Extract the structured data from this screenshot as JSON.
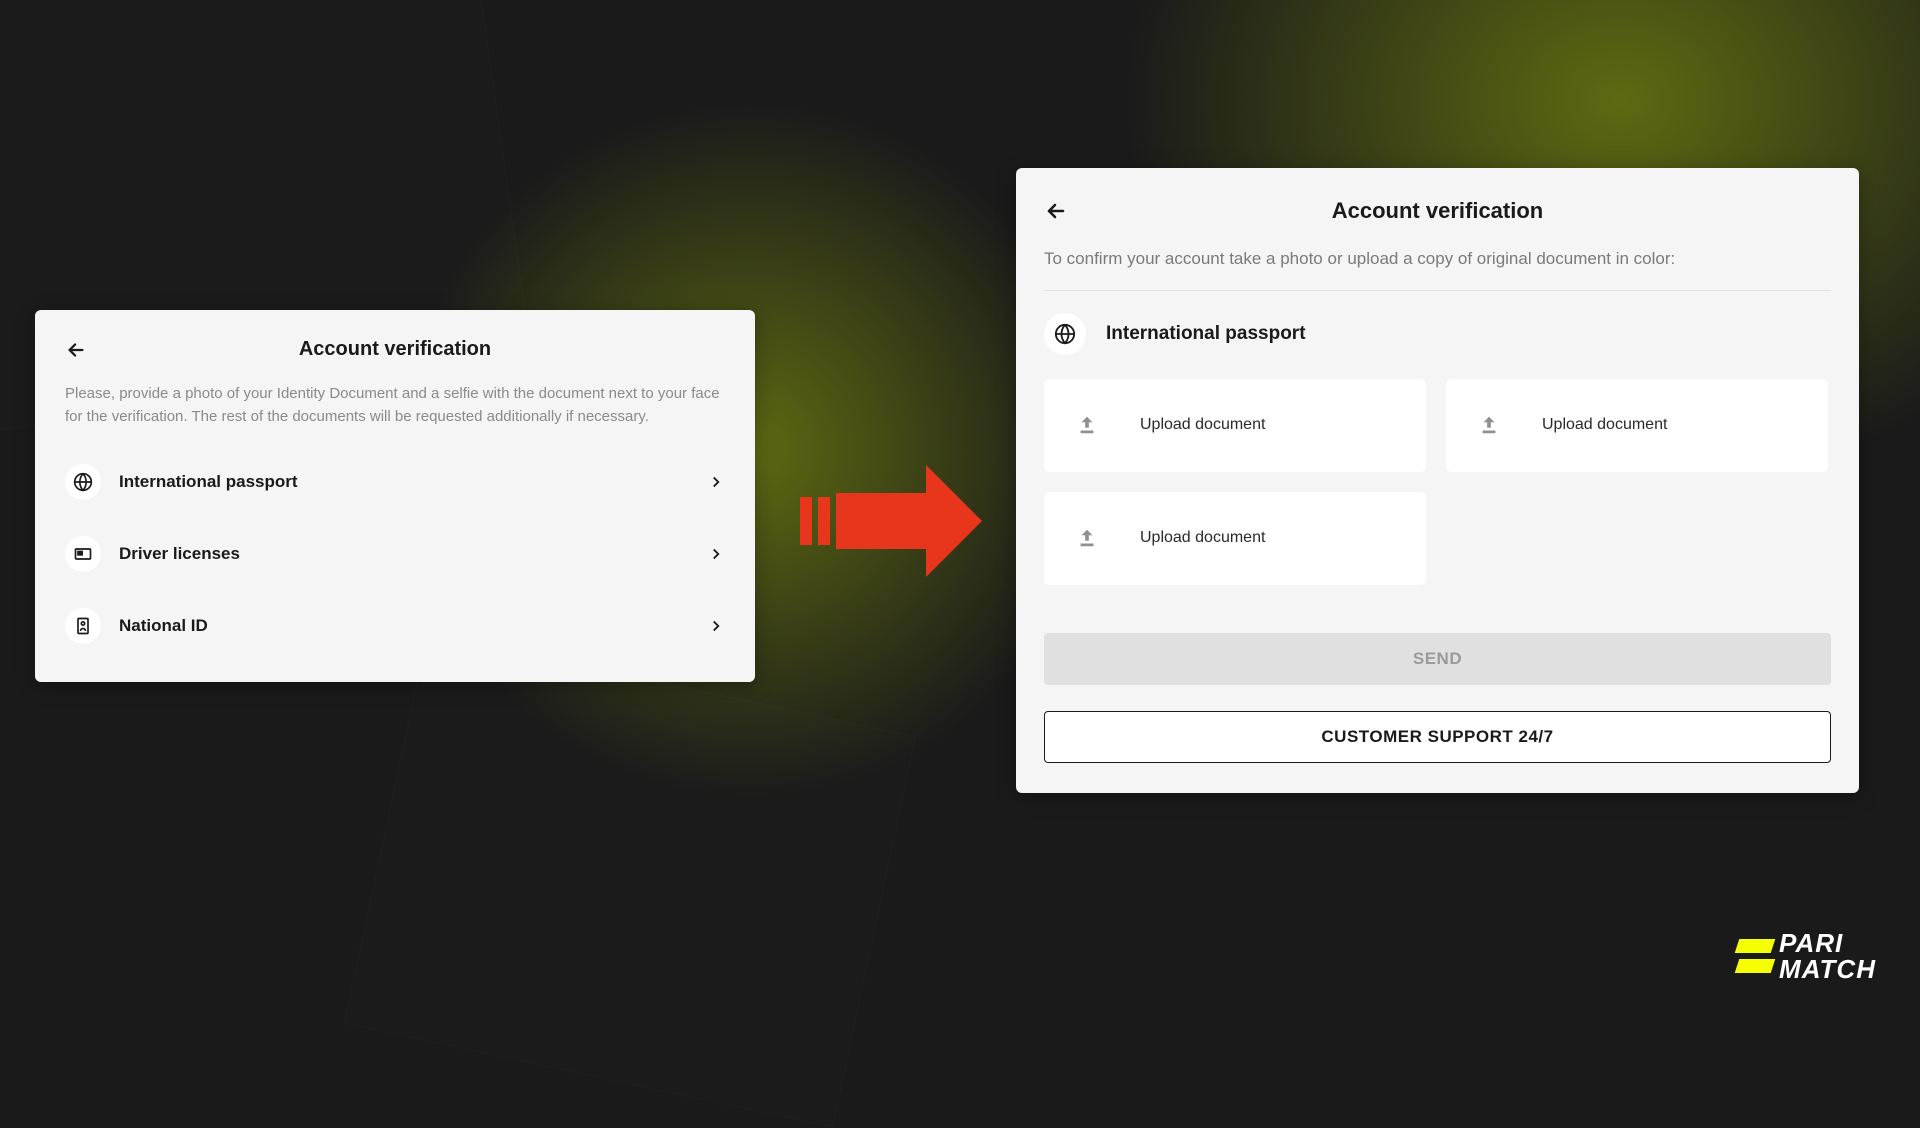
{
  "left_panel": {
    "title": "Account verification",
    "description": "Please, provide a photo of your Identity Document and a selfie with the document next to your face for the verification. The rest of the documents will be requested additionally if necessary.",
    "options": [
      {
        "label": "International passport"
      },
      {
        "label": "Driver licenses"
      },
      {
        "label": "National ID"
      }
    ]
  },
  "right_panel": {
    "title": "Account verification",
    "description": "To confirm your account take a photo or upload a copy of original document in color:",
    "selected_doc": "International passport",
    "upload_label": "Upload document",
    "send_label": "SEND",
    "support_label": "CUSTOMER SUPPORT 24/7"
  },
  "logo": {
    "line1": "PARI",
    "line2": "MATCH"
  }
}
